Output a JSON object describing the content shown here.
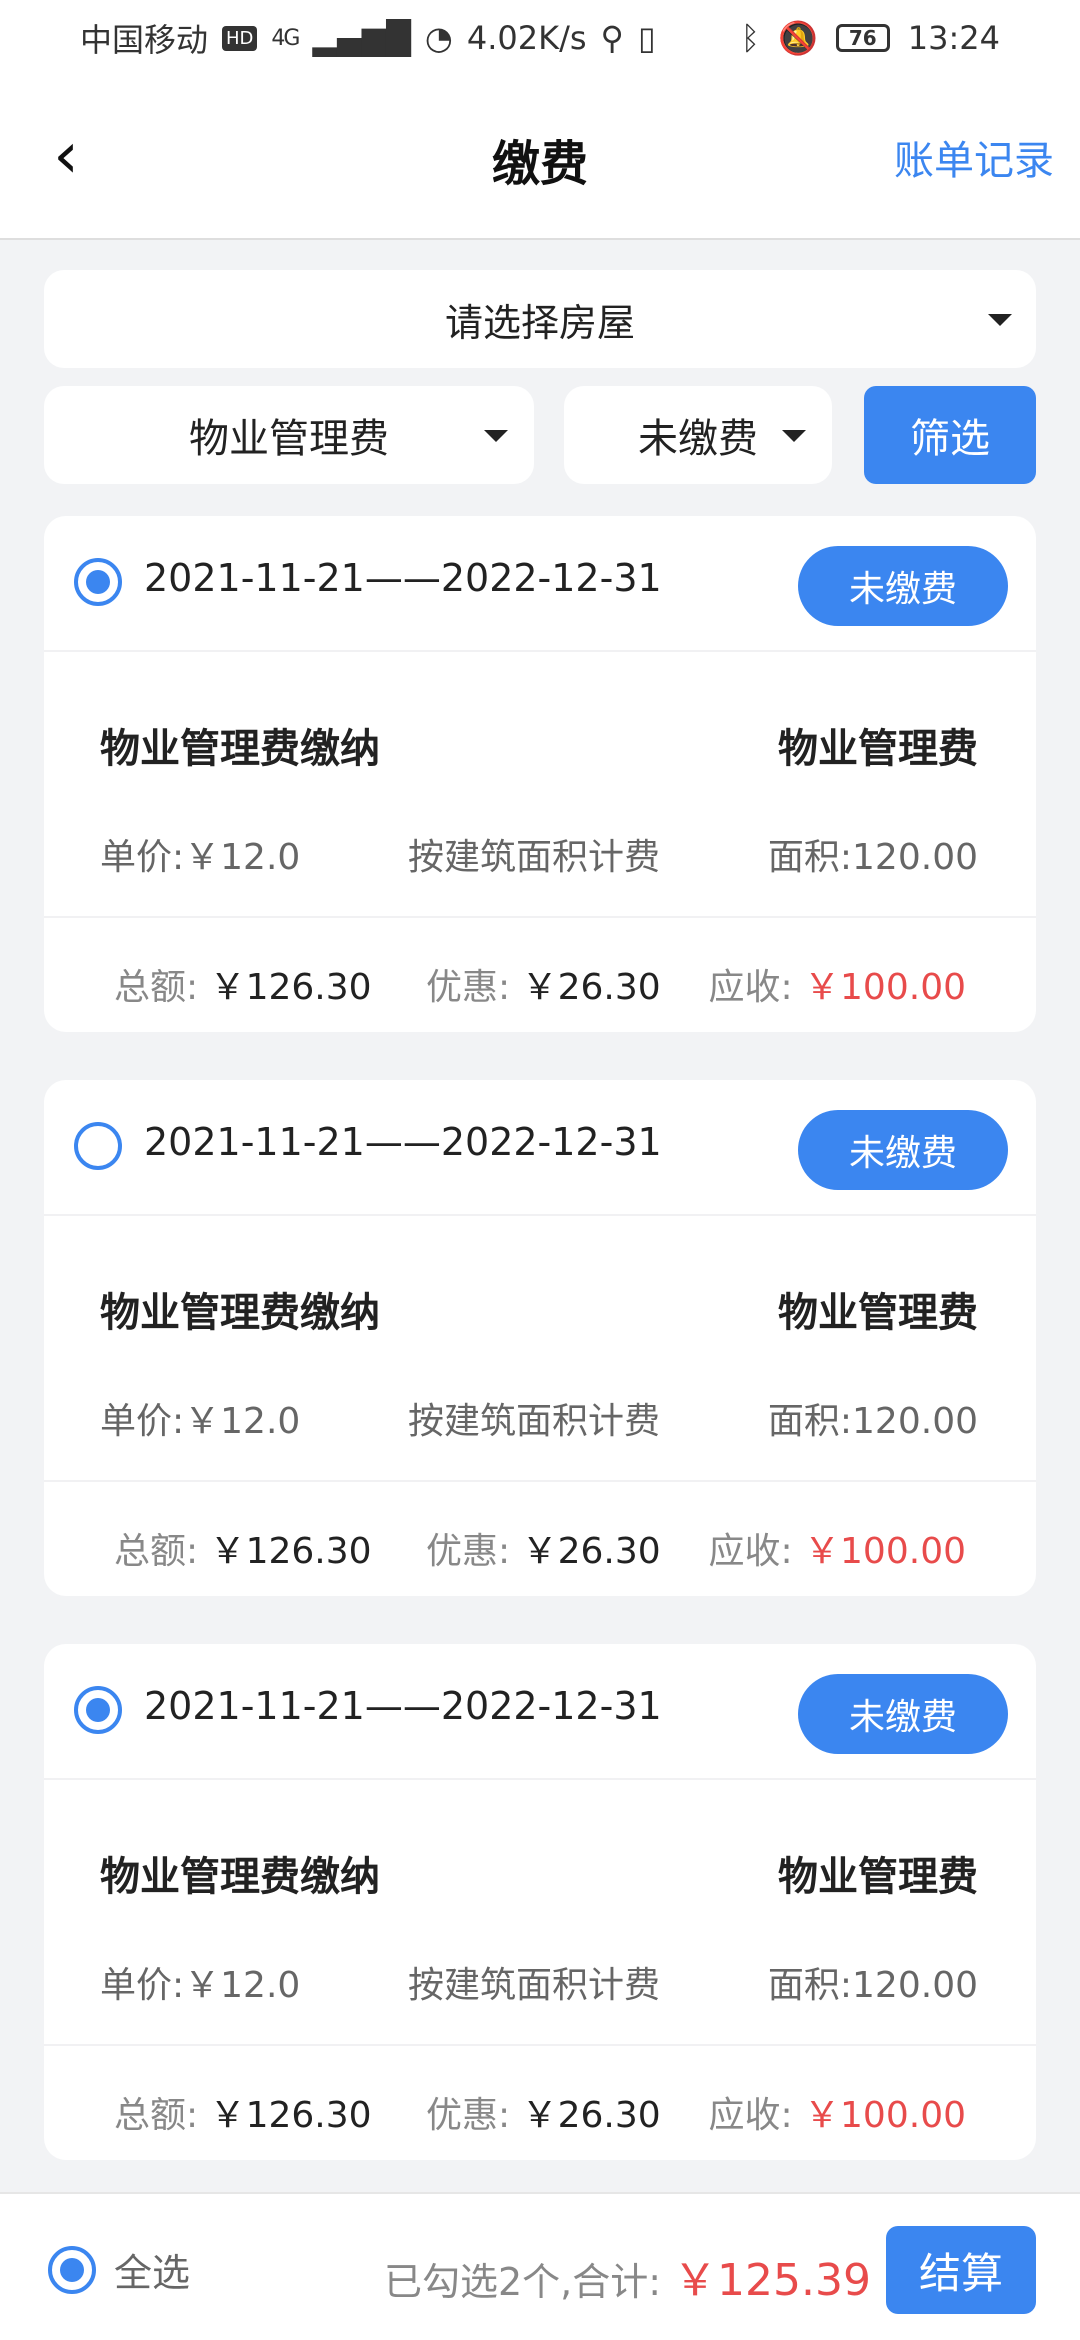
{
  "status_bar": {
    "carrier": "中国移动",
    "hd": "HD",
    "net": "4G",
    "speed": "4.02K/s",
    "battery": "76",
    "time": "13:24"
  },
  "header": {
    "title": "缴费",
    "right_link": "账单记录"
  },
  "filters": {
    "house_placeholder": "请选择房屋",
    "fee_type": "物业管理费",
    "status": "未缴费",
    "filter_button": "筛选"
  },
  "bills": [
    {
      "checked": true,
      "period": "2021-11-21——2022-12-31",
      "status": "未缴费",
      "name": "物业管理费缴纳",
      "type": "物业管理费",
      "unit_price_label": "单价:",
      "unit_price": "￥12.0",
      "method": "按建筑面积计费",
      "area_label": "面积:",
      "area": "120.00",
      "total_label": "总额:",
      "total": "￥126.30",
      "discount_label": "优惠:",
      "discount": "￥26.30",
      "receivable_label": "应收:",
      "receivable": "￥100.00"
    },
    {
      "checked": false,
      "period": "2021-11-21——2022-12-31",
      "status": "未缴费",
      "name": "物业管理费缴纳",
      "type": "物业管理费",
      "unit_price_label": "单价:",
      "unit_price": "￥12.0",
      "method": "按建筑面积计费",
      "area_label": "面积:",
      "area": "120.00",
      "total_label": "总额:",
      "total": "￥126.30",
      "discount_label": "优惠:",
      "discount": "￥26.30",
      "receivable_label": "应收:",
      "receivable": "￥100.00"
    },
    {
      "checked": true,
      "period": "2021-11-21——2022-12-31",
      "status": "未缴费",
      "name": "物业管理费缴纳",
      "type": "物业管理费",
      "unit_price_label": "单价:",
      "unit_price": "￥12.0",
      "method": "按建筑面积计费",
      "area_label": "面积:",
      "area": "120.00",
      "total_label": "总额:",
      "total": "￥126.30",
      "discount_label": "优惠:",
      "discount": "￥26.30",
      "receivable_label": "应收:",
      "receivable": "￥100.00"
    }
  ],
  "footer": {
    "select_all": "全选",
    "selected_summary": "已勾选2个,合计:",
    "selected_total": "￥125.39",
    "checkout": "结算"
  },
  "colors": {
    "accent": "#3b86f0",
    "price_red": "#e84b4b",
    "background": "#f2f3f5"
  }
}
